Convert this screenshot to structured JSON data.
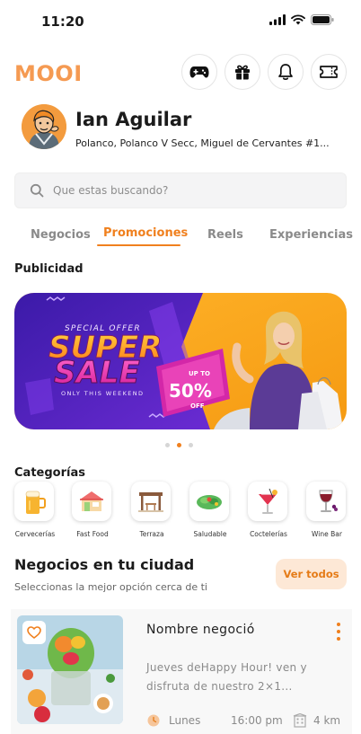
{
  "status_bar": {
    "time": "11:20"
  },
  "header": {
    "logo": "MOOI"
  },
  "user": {
    "name": "Ian Aguilar",
    "address": "Polanco, Polanco V Secc, Miguel de Cervantes #1..."
  },
  "search": {
    "placeholder": "Que estas buscando?"
  },
  "tabs": [
    {
      "label": "Negocios",
      "active": false
    },
    {
      "label": "Promociones",
      "active": true
    },
    {
      "label": "Reels",
      "active": false
    },
    {
      "label": "Experiencias",
      "active": false
    }
  ],
  "ads": {
    "title": "Publicidad",
    "banner": {
      "line1": "SPECIAL OFFER",
      "line2": "SUPER",
      "line3": "SALE",
      "line4": "ONLY THIS WEEKEND",
      "badge_top": "UP TO",
      "badge_mid": "50%",
      "badge_bot": "OFF"
    },
    "page_count": 3,
    "active_page": 2
  },
  "categories": {
    "title": "Categorías",
    "items": [
      {
        "label": "Cervecerías",
        "icon": "beer-icon"
      },
      {
        "label": "Fast Food",
        "icon": "fast-food-icon"
      },
      {
        "label": "Terraza",
        "icon": "terrace-icon"
      },
      {
        "label": "Saludable",
        "icon": "healthy-icon"
      },
      {
        "label": "Coctelerías",
        "icon": "cocktail-icon"
      },
      {
        "label": "Wine Bar",
        "icon": "wine-icon"
      }
    ]
  },
  "nearby": {
    "title": "Negocios en tu ciudad",
    "subtitle": "Seleccionas la mejor opción  cerca de ti",
    "see_all": "Ver todos",
    "card": {
      "name": "Nombre negoció",
      "description": "Jueves deHappy Hour! ven y disfruta de nuestro 2×1...",
      "day": "Lunes",
      "time": "16:00 pm",
      "distance": "4 km"
    }
  },
  "colors": {
    "accent": "#f0801e",
    "logo": "#f59a52",
    "see_all_bg": "#fde8d6"
  }
}
